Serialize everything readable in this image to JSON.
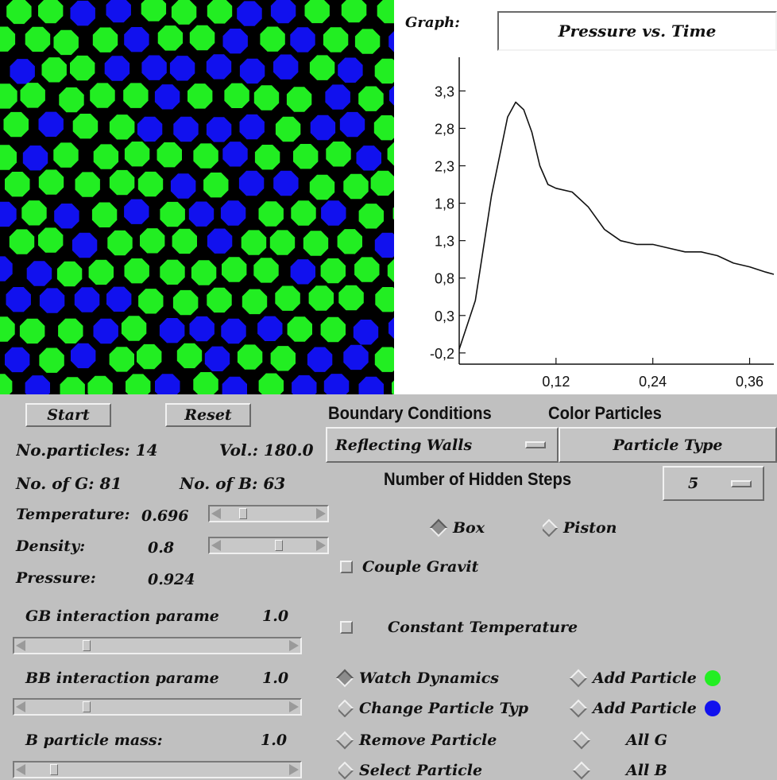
{
  "graph": {
    "label": "Graph:",
    "title": "Pressure vs. Time",
    "y_ticks": [
      "3,3",
      "2,8",
      "2,3",
      "1,8",
      "1,3",
      "0,8",
      "0,3",
      "-0,2"
    ],
    "x_ticks": [
      "0,12",
      "0,24",
      "0,36"
    ]
  },
  "chart_data": {
    "type": "line",
    "title": "Pressure vs. Time",
    "xlim": [
      0,
      0.39
    ],
    "ylim": [
      -0.35,
      3.75
    ],
    "x": [
      0.0,
      0.02,
      0.04,
      0.06,
      0.07,
      0.08,
      0.09,
      0.1,
      0.11,
      0.12,
      0.14,
      0.16,
      0.18,
      0.2,
      0.22,
      0.24,
      0.26,
      0.28,
      0.3,
      0.32,
      0.34,
      0.36,
      0.38,
      0.39
    ],
    "y": [
      -0.15,
      0.5,
      1.9,
      2.95,
      3.15,
      3.05,
      2.75,
      2.3,
      2.05,
      2.0,
      1.95,
      1.75,
      1.45,
      1.3,
      1.25,
      1.25,
      1.2,
      1.15,
      1.15,
      1.1,
      1.0,
      0.95,
      0.88,
      0.85
    ]
  },
  "controls": {
    "start": "Start",
    "reset": "Reset",
    "no_particles": "No.particles: 14",
    "vol": "Vol.: 180.0",
    "no_g": "No. of G: 81",
    "no_b": "No. of B: 63",
    "temperature_label": "Temperature:",
    "temperature_value": "0.696",
    "temperature_slider": 0.2,
    "density_label": "Density:",
    "density_value": "0.8",
    "density_slider": 0.62,
    "pressure_label": "Pressure:",
    "pressure_value": "0.924",
    "gb_label": "GB interaction parame",
    "gb_value": "1.0",
    "gb_slider": 0.22,
    "bb_label": "BB interaction parame",
    "bb_value": "1.0",
    "bb_slider": 0.22,
    "bmass_label": "B particle mass:",
    "bmass_value": "1.0",
    "bmass_slider": 0.09
  },
  "right": {
    "boundary_heading": "Boundary Conditions",
    "color_heading": "Color Particles",
    "boundary_value": "Reflecting Walls",
    "color_value": "Particle Type",
    "hidden_steps_label": "Number of Hidden Steps",
    "hidden_steps_value": "5",
    "box": "Box",
    "piston": "Piston",
    "couple_gravity": "Couple Gravit",
    "constant_temperature": "Constant Temperature",
    "watch_dynamics": "Watch Dynamics",
    "change_particle_type": "Change Particle Typ",
    "remove_particle": "Remove Particle",
    "select_particle": "Select Particle",
    "add_particle_g": "Add Particle",
    "add_particle_b": "Add Particle",
    "all_g": "All G",
    "all_b": "All B"
  },
  "colors": {
    "green_particle": "#22ee22",
    "blue_particle": "#1111ee",
    "background": "#000000"
  }
}
